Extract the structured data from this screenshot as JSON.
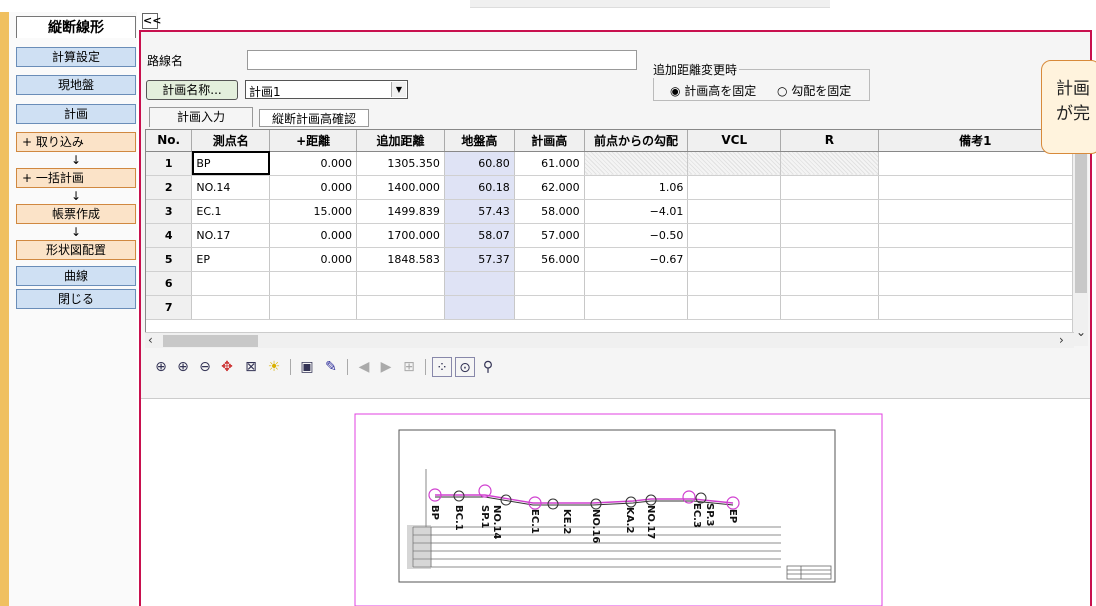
{
  "sidebar": {
    "tab_title": "縦断線形",
    "buttons": [
      "計算設定",
      "現地盤",
      "計画"
    ],
    "flow": [
      "+ 取り込み",
      "↓",
      "+ 一括計画",
      "↓",
      "帳票作成",
      "↓",
      "形状図配置"
    ],
    "bottom": [
      "曲線",
      "閉じる"
    ]
  },
  "collapse_label": "<<",
  "form": {
    "route_label": "路線名",
    "route_value": "",
    "plan_name_button": "計画名称...",
    "plan_select_value": "計画1",
    "group_title": "追加距離変更時",
    "radio_fixed_height": "計画高を固定",
    "radio_fixed_slope": "勾配を固定",
    "radio_selected": "計画高を固定"
  },
  "tabs": [
    "計画入力",
    "縦断計画高確認"
  ],
  "grid": {
    "headers": [
      "No.",
      "測点名",
      "+距離",
      "追加距離",
      "地盤高",
      "計画高",
      "前点からの勾配",
      "VCL",
      "R",
      "備考1"
    ],
    "rows": [
      [
        "1",
        "BP",
        "0.000",
        "1305.350",
        "60.80",
        "61.000",
        "",
        "",
        "",
        ""
      ],
      [
        "2",
        "NO.14",
        "0.000",
        "1400.000",
        "60.18",
        "62.000",
        "1.06",
        "",
        "",
        ""
      ],
      [
        "3",
        "EC.1",
        "15.000",
        "1499.839",
        "57.43",
        "58.000",
        "−4.01",
        "",
        "",
        ""
      ],
      [
        "4",
        "NO.17",
        "0.000",
        "1700.000",
        "58.07",
        "57.000",
        "−0.50",
        "",
        "",
        ""
      ],
      [
        "5",
        "EP",
        "0.000",
        "1848.583",
        "57.37",
        "56.000",
        "−0.67",
        "",
        "",
        ""
      ],
      [
        "6",
        "",
        "",
        "",
        "",
        "",
        "",
        "",
        "",
        ""
      ],
      [
        "7",
        "",
        "",
        "",
        "",
        "",
        "",
        "",
        "",
        ""
      ]
    ]
  },
  "toolbar_icons": [
    "zoom-fit-icon",
    "zoom-in-icon",
    "zoom-out-icon",
    "pan-icon",
    "zoom-window-icon",
    "light-icon",
    "page-icon",
    "pen-icon",
    "prev-icon",
    "next-icon",
    "layout-icon",
    "select-points-icon",
    "select-window-icon",
    "search-icon"
  ],
  "tooltip": [
    "計画",
    "が完"
  ],
  "drawing_labels": [
    "BP",
    "BC.1",
    "SP.1",
    "NO.14",
    "EC.1",
    "KE.2",
    "NO.16",
    "KA.2",
    "NO.17",
    "EC.3",
    "SP.3",
    "EP"
  ]
}
